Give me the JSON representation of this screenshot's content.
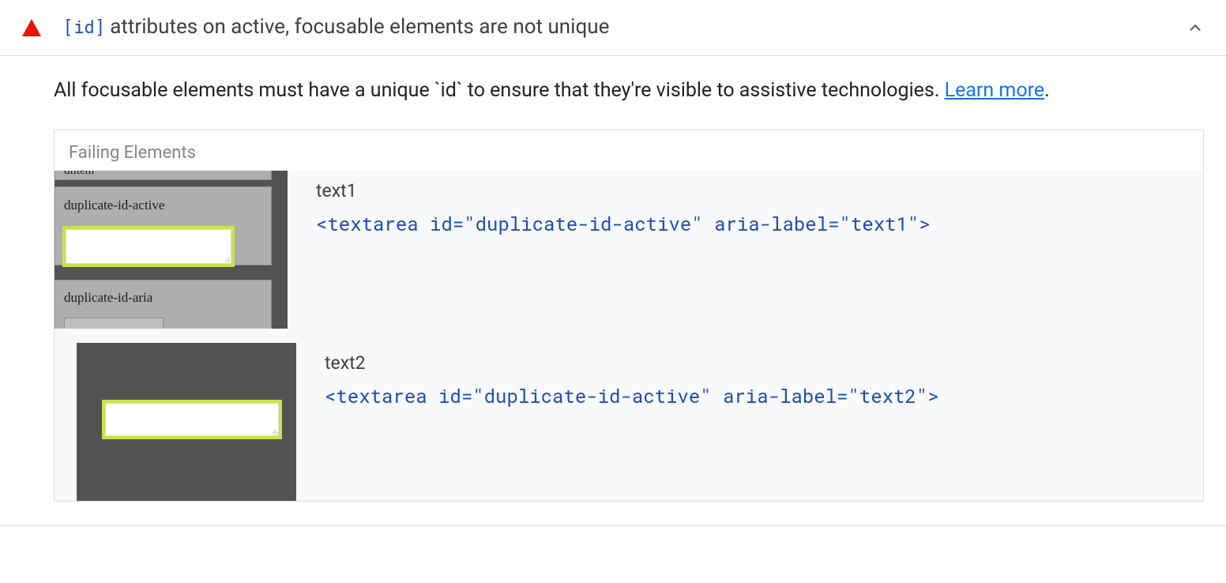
{
  "header": {
    "code_token": "[id]",
    "title_rest": " attributes on active, focusable elements are not unique"
  },
  "description": {
    "text": "All focusable elements must have a unique `id` to ensure that they're visible to assistive technologies. ",
    "learn_more": "Learn more",
    "period": "."
  },
  "panel": {
    "title": "Failing Elements"
  },
  "failing": [
    {
      "label": "text1",
      "code": "<textarea id=\"duplicate-id-active\" aria-label=\"text1\">",
      "thumb": {
        "line_top": "dlitem",
        "line_mid": "duplicate-id-active",
        "line_bottom": "duplicate-id-aria"
      }
    },
    {
      "label": "text2",
      "code": "<textarea id=\"duplicate-id-active\" aria-label=\"text2\">",
      "thumb": {}
    }
  ]
}
